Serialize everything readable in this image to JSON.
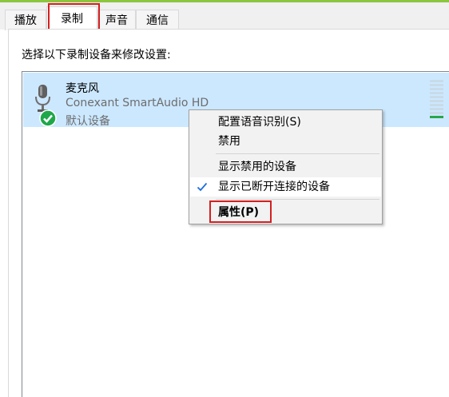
{
  "tabs": [
    {
      "label": "播放",
      "active": false
    },
    {
      "label": "录制",
      "active": true
    },
    {
      "label": "声音",
      "active": false
    },
    {
      "label": "通信",
      "active": false
    }
  ],
  "instruction": "选择以下录制设备来修改设置:",
  "device": {
    "name": "麦克风",
    "description": "Conexant SmartAudio HD",
    "status": "默认设备",
    "icon": "microphone-icon",
    "badge_icon": "default-device-check-icon"
  },
  "context_menu": {
    "items": [
      {
        "label": "配置语音识别(S)"
      },
      {
        "label": "禁用"
      },
      {
        "label": "显示禁用的设备"
      },
      {
        "label": "显示已断开连接的设备",
        "checked": true
      },
      {
        "label": "属性(P)",
        "bold": true
      }
    ]
  },
  "colors": {
    "accent_bar": "#8cc63f",
    "selection": "#cce8ff",
    "annotation_box": "#d41f1f",
    "level_active": "#2aa64a",
    "check_badge": "#1fa84a"
  }
}
